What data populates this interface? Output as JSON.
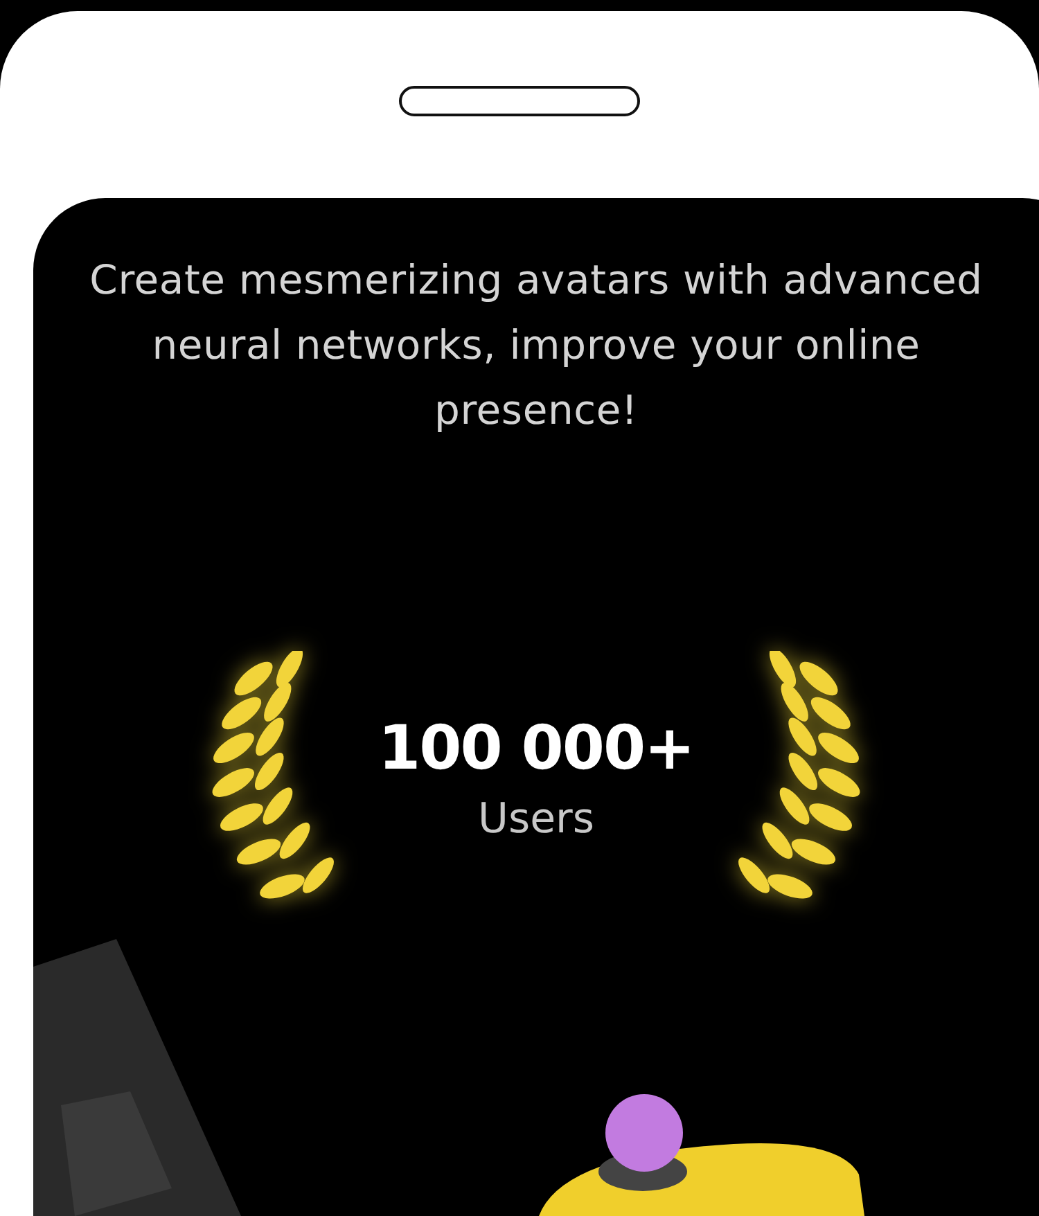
{
  "tagline": "Create mesmerizing avatars with advanced neural networks, improve your online presence!",
  "stat": {
    "value": "100 000+",
    "label": "Users"
  }
}
